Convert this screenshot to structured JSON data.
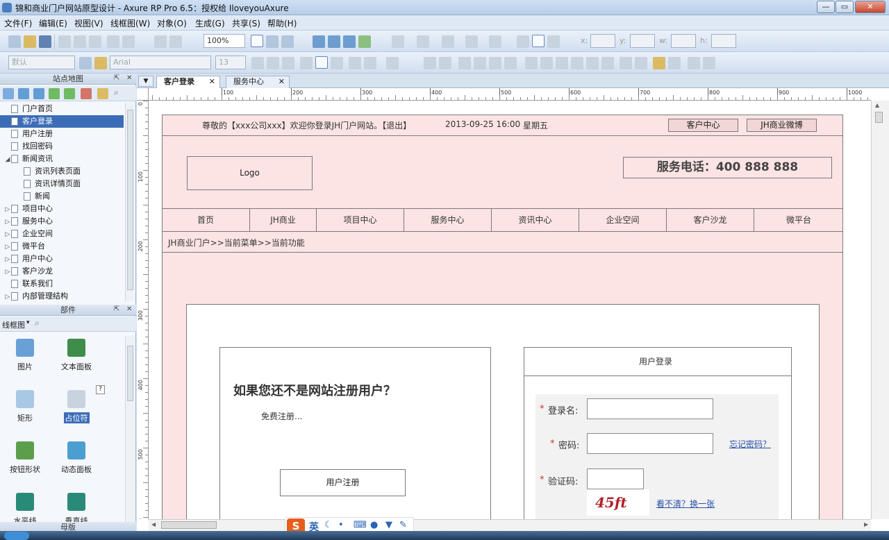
{
  "window": {
    "title": "锦和商业门户网站原型设计 - Axure RP Pro 6.5：授权给 IloveyouAxure",
    "min": "—",
    "max": "▭",
    "close": "✕"
  },
  "menu": [
    "文件(F)",
    "编辑(E)",
    "视图(V)",
    "线框图(W)",
    "对象(O)",
    "生成(G)",
    "共享(S)",
    "帮助(H)"
  ],
  "toolbar": {
    "zoom": "100%",
    "x_label": "x:",
    "y_label": "y:",
    "w_label": "w:",
    "h_label": "h:",
    "style": "默认",
    "font": "Arial",
    "size": "13"
  },
  "sitemap": {
    "title": "站点地图",
    "items": [
      {
        "label": "门户首页",
        "level": 0,
        "expander": ""
      },
      {
        "label": "客户登录",
        "level": 0,
        "expander": "",
        "selected": true
      },
      {
        "label": "用户注册",
        "level": 0,
        "expander": ""
      },
      {
        "label": "找回密码",
        "level": 0,
        "expander": ""
      },
      {
        "label": "新闻资讯",
        "level": 0,
        "expander": "◢"
      },
      {
        "label": "资讯列表页面",
        "level": 1,
        "expander": ""
      },
      {
        "label": "资讯详情页面",
        "level": 1,
        "expander": ""
      },
      {
        "label": "新闻",
        "level": 1,
        "expander": ""
      },
      {
        "label": "项目中心",
        "level": 0,
        "expander": "▷"
      },
      {
        "label": "服务中心",
        "level": 0,
        "expander": "▷"
      },
      {
        "label": "企业空间",
        "level": 0,
        "expander": "▷"
      },
      {
        "label": "微平台",
        "level": 0,
        "expander": "▷"
      },
      {
        "label": "用户中心",
        "level": 0,
        "expander": "▷"
      },
      {
        "label": "客户沙龙",
        "level": 0,
        "expander": "▷"
      },
      {
        "label": "联系我们",
        "level": 0,
        "expander": ""
      },
      {
        "label": "内部管理结构",
        "level": 0,
        "expander": "▷"
      }
    ]
  },
  "widgets": {
    "title": "部件",
    "library": "线框图",
    "items": [
      {
        "label": "图片",
        "icon": "image-icon",
        "color": "#6aa0d8"
      },
      {
        "label": "文本面板",
        "icon": "text-panel-icon",
        "color": "#3f8d4a"
      },
      {
        "label": "矩形",
        "icon": "rectangle-icon",
        "color": "#a9c8e6"
      },
      {
        "label": "占位符",
        "icon": "placeholder-icon",
        "color": "#c8d3df"
      },
      {
        "label": "按钮形状",
        "icon": "button-shape-icon",
        "color": "#5c9f4b"
      },
      {
        "label": "动态面板",
        "icon": "dynamic-panel-icon",
        "color": "#4b9fd0"
      },
      {
        "label": "水平线",
        "icon": "hline-icon",
        "color": "#2a8a7a"
      },
      {
        "label": "垂直线",
        "icon": "vline-icon",
        "color": "#2a8a7a"
      }
    ],
    "masters_title": "母版"
  },
  "tabs": [
    {
      "label": "客户登录",
      "active": true
    },
    {
      "label": "服务中心",
      "active": false
    }
  ],
  "ruler": {
    "h": [
      "100",
      "200",
      "300",
      "400",
      "500",
      "600",
      "700",
      "800",
      "900",
      "1000"
    ],
    "v": [
      "0",
      "100",
      "200",
      "300",
      "400",
      "500",
      "600"
    ]
  },
  "design": {
    "topbar": {
      "welcome": "尊敬的【xxx公司xxx】欢迎你登录JH门户网站。【退出】",
      "datetime": "2013-09-25 16:00",
      "weekday": "星期五",
      "btn1": "客户中心",
      "btn2": "JH商业微博"
    },
    "logo": "Logo",
    "hotline": "服务电话：400 888 888",
    "nav": [
      "首页",
      "JH商业",
      "项目中心",
      "服务中心",
      "资讯中心",
      "企业空间",
      "客户沙龙",
      "微平台"
    ],
    "breadcrumb": "JH商业门户>>当前菜单>>当前功能",
    "register": {
      "heading": "如果您还不是网站注册用户？",
      "sub": "免费注册...",
      "button": "用户注册"
    },
    "login": {
      "title": "用户登录",
      "required": "*",
      "username_label": "登录名:",
      "password_label": "密码:",
      "forgot": "忘记密码？",
      "captcha_label": "验证码:",
      "captcha_image": "45ft",
      "refresh": "看不清？换一张"
    }
  },
  "ime": {
    "label": "英"
  }
}
